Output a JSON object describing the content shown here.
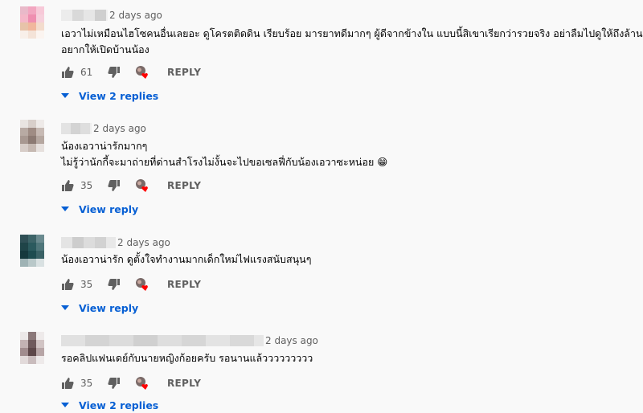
{
  "comments": [
    {
      "time": "2 days ago",
      "lines": [
        "เอวาไม่เหมือนไฮโซคนอื่นเลยอะ ดูโครตติดดิน เรียบร้อย มารยาทดีมากๆ ผู้ดีจากข้างใน แบบนี้สิเขาเรียกว่ารวยจริง อย่าลืมไปดูให้ถึงล้าน",
        "อยากให้เปิดบ้านน้อง"
      ],
      "likes": "61",
      "reply_label": "REPLY",
      "view_label": "View 2 replies"
    },
    {
      "time": "2 days ago",
      "lines": [
        "น้องเอวาน่ารักมากๆ",
        "ไม่รู้ว่านักกี้จะมาถ่ายที่ด่านสำโรงไม่งั้นจะไปขอเซลฟี่กับน้องเอวาซะหน่อย 😁"
      ],
      "likes": "35",
      "reply_label": "REPLY",
      "view_label": "View reply"
    },
    {
      "time": "2 days ago",
      "lines": [
        "น้องเอวาน่ารัก ดูตั้งใจทำงานมากเด็กใหม่ไฟแรงสนับสนุนๆ"
      ],
      "likes": "35",
      "reply_label": "REPLY",
      "view_label": "View reply"
    },
    {
      "time": "2 days ago",
      "lines": [
        "รอคลิปแฟนเดย์กับนายหญิงก้อยครับ รอนานแล้ววววววววว"
      ],
      "likes": "35",
      "reply_label": "REPLY",
      "view_label": "View 2 replies"
    }
  ],
  "icons": {
    "like": "thumbs-up-icon",
    "dislike": "thumbs-down-icon",
    "creator_heart": "creator-heart-icon",
    "expand": "caret-down-icon"
  },
  "colors": {
    "link": "#065fd4",
    "secondary_text": "#606060",
    "heart": "#ff0000"
  }
}
